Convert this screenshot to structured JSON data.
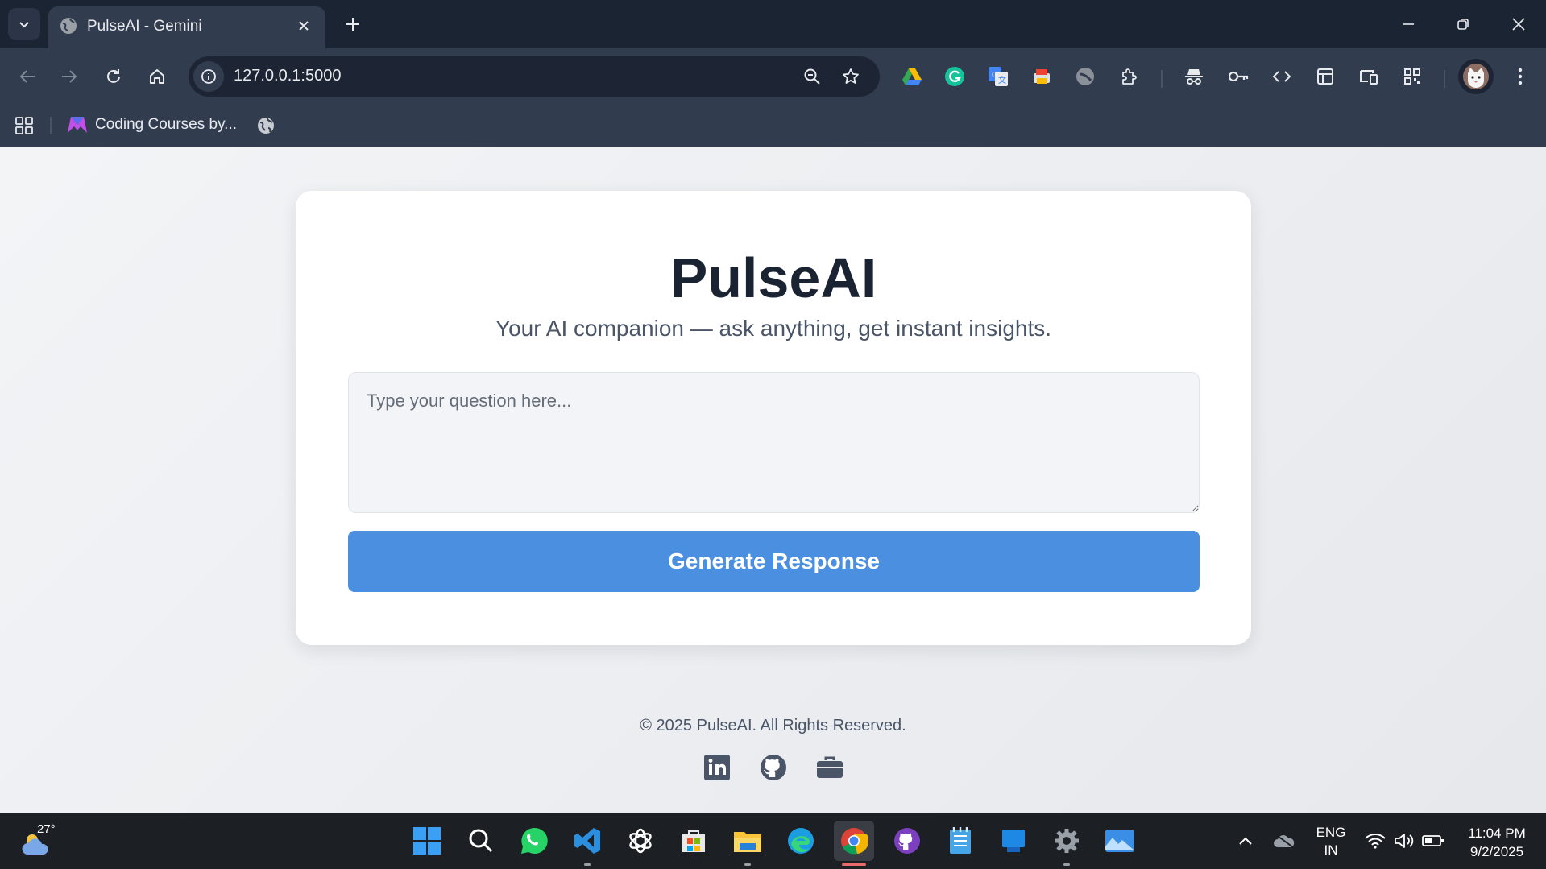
{
  "browser": {
    "tab_title": "PulseAI - Gemini",
    "url": "127.0.0.1:5000",
    "bookmark_label": "Coding Courses by..."
  },
  "page": {
    "title": "PulseAI",
    "subtitle": "Your AI companion — ask anything, get instant insights.",
    "question_placeholder": "Type your question here...",
    "generate_label": "Generate Response",
    "footer": "© 2025 PulseAI. All Rights Reserved."
  },
  "taskbar": {
    "temperature": "27°",
    "lang_line1": "ENG",
    "lang_line2": "IN",
    "time": "11:04 PM",
    "date": "9/2/2025"
  },
  "colors": {
    "accent": "#4a8fe0",
    "title_text": "#1a2332",
    "chrome_dark": "#1b2433",
    "chrome_toolbar": "#323c4f"
  }
}
